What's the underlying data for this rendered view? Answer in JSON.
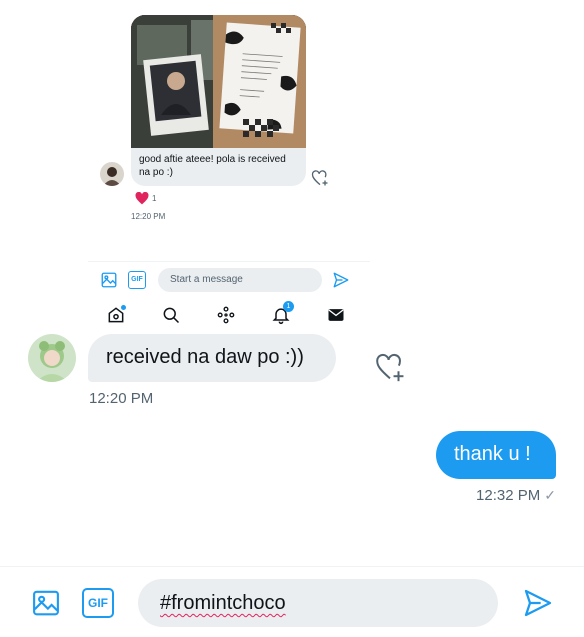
{
  "nested": {
    "caption": "good aftie ateee! pola is received na po :)",
    "reaction_count": "1",
    "time": "12:20 PM",
    "composer_placeholder": "Start a message",
    "gif_label": "GIF",
    "notification_badge": "1"
  },
  "conversation": {
    "incoming_message": "received na daw po :))",
    "incoming_time": "12:20 PM",
    "outgoing_message": "thank u !",
    "outgoing_time": "12:32 PM",
    "outgoing_status_icon": "✓"
  },
  "composer": {
    "gif_label": "GIF",
    "input_value": "#fromintchoco"
  },
  "colors": {
    "accent": "#1d9bf0",
    "bubble_gray": "#ebeef0",
    "muted_text": "#536471",
    "reaction_red": "#e0245e"
  },
  "icons": {
    "media": "image-icon",
    "gif": "gif-icon",
    "send": "send-icon",
    "like": "heart-plus-icon",
    "home": "home-icon",
    "search": "search-icon",
    "spaces": "spaces-icon",
    "notifications": "bell-icon",
    "messages": "envelope-icon"
  }
}
